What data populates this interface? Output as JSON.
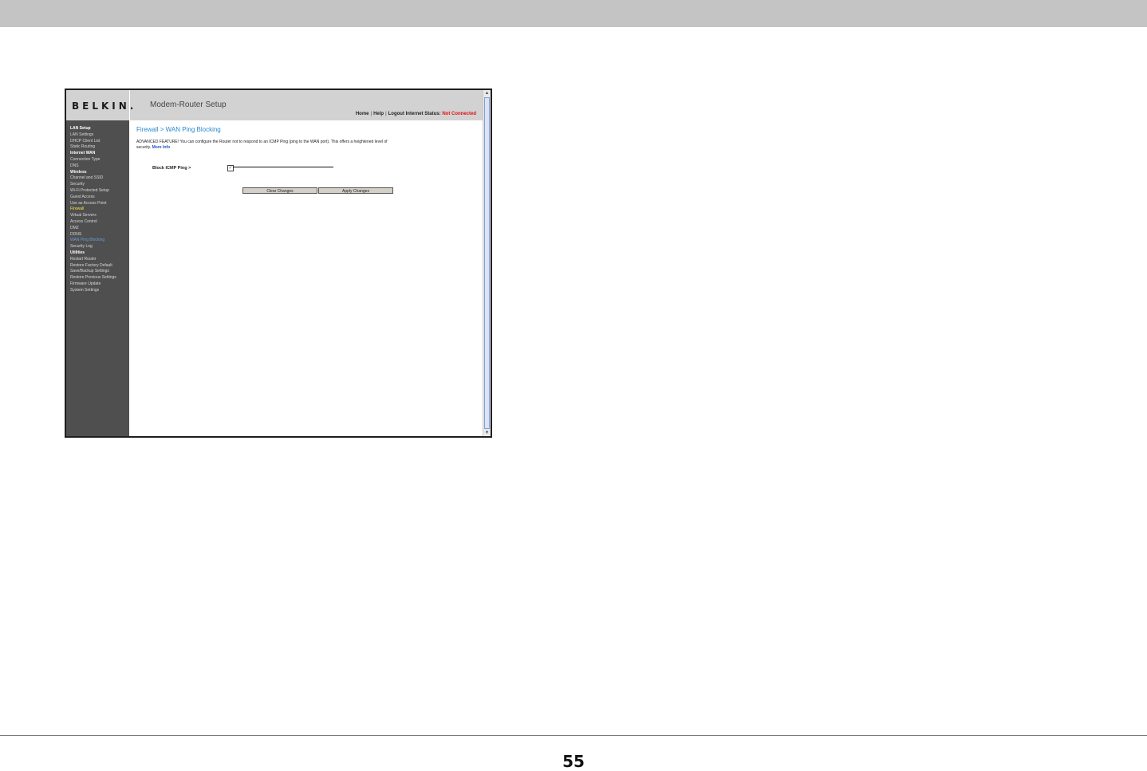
{
  "router": {
    "logo": "BELKIN.",
    "app_title": "Modem-Router Setup",
    "nav": {
      "home": "Home",
      "help": "Help",
      "logout": "Logout",
      "status_label": "Internet Status:",
      "status_value": "Not Connected"
    },
    "sidebar": [
      {
        "label": "LAN Setup",
        "type": "head"
      },
      {
        "label": "LAN Settings",
        "type": "item"
      },
      {
        "label": "DHCP Client List",
        "type": "item"
      },
      {
        "label": "Static Routing",
        "type": "item"
      },
      {
        "label": "Internet WAN",
        "type": "head"
      },
      {
        "label": "Connection Type",
        "type": "item"
      },
      {
        "label": "DNS",
        "type": "item"
      },
      {
        "label": "Wireless",
        "type": "head"
      },
      {
        "label": "Channel and SSID",
        "type": "item"
      },
      {
        "label": "Security",
        "type": "item"
      },
      {
        "label": "Wi-Fi Protected Setup",
        "type": "item"
      },
      {
        "label": "Guest Access",
        "type": "item"
      },
      {
        "label": "Use as Access Point",
        "type": "item"
      },
      {
        "label": "Firewall",
        "type": "hl"
      },
      {
        "label": "Virtual Servers",
        "type": "item"
      },
      {
        "label": "Access Control",
        "type": "item"
      },
      {
        "label": "DMZ",
        "type": "item"
      },
      {
        "label": "DDNS",
        "type": "item"
      },
      {
        "label": "WAN Ping Blocking",
        "type": "active"
      },
      {
        "label": "Security Log",
        "type": "item"
      },
      {
        "label": "Utilities",
        "type": "head"
      },
      {
        "label": "Restart Router",
        "type": "item"
      },
      {
        "label": "Restore Factory Default",
        "type": "item"
      },
      {
        "label": "Save/Backup Settings",
        "type": "item"
      },
      {
        "label": "Restore Previous Settings",
        "type": "item"
      },
      {
        "label": "Firmware Update",
        "type": "item"
      },
      {
        "label": "System Settings",
        "type": "item"
      }
    ],
    "content": {
      "title": "Firewall > WAN Ping Blocking",
      "description": "ADVANCED FEATURE! You can configure the Router not to respond to an ICMP Ping (ping to the WAN port). This offers a heightened level of security.",
      "more_info": "More Info",
      "field_label": "Block ICMP Ping >",
      "checkbox_checked": true,
      "clear_button": "Clear Changes",
      "apply_button": "Apply Changes"
    }
  },
  "page_number": "55"
}
